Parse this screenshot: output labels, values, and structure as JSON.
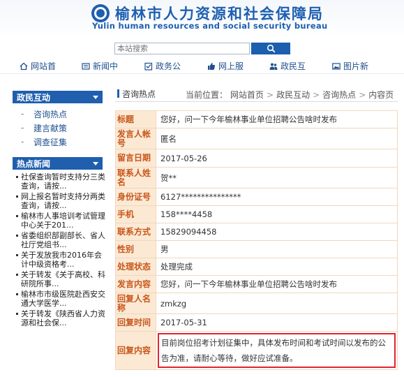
{
  "site": {
    "title": "榆林市人力资源和社会保障局",
    "subtitle": "Yulin human resources and social security bureau"
  },
  "search": {
    "placeholder": "本站搜索"
  },
  "nav": [
    {
      "label": "网站首",
      "icon": "home-icon"
    },
    {
      "label": "新闻中",
      "icon": "newspaper-icon"
    },
    {
      "label": "政务公",
      "icon": "checkbox-icon"
    },
    {
      "label": "网上服",
      "icon": "thumbs-up-icon"
    },
    {
      "label": "政民互",
      "icon": "people-icon"
    },
    {
      "label": "图片新",
      "icon": "image-icon"
    }
  ],
  "sidebar": {
    "section1_title": "政民互动",
    "section1_items": [
      "咨询热点",
      "建言献策",
      "调查征集"
    ],
    "section2_title": "热点新闻",
    "hot_news": [
      "社保查询暂时支持分三类查询，请按...",
      "网上报名暂时支持分两类查询，请按...",
      "榆林市人事培训考试管理中心关于201...",
      "省委组织部副部长、省人社厅党组书...",
      "关于发放我市2016年会计中级资格考...",
      "关于转发《关于高校、科研院所事...",
      "榆林市市级医院赴西安交通大学医学...",
      "关于转发《陕西省人力资源和社会保..."
    ]
  },
  "breadcrumb": {
    "section_title": "咨询热点",
    "location_label": "当前位置：",
    "path": [
      "网站首页",
      "政民互动",
      "咨询热点",
      "内容页"
    ]
  },
  "detail": {
    "rows": [
      {
        "label": "标题",
        "value": "您好，问一下今年榆林事业单位招聘公告啥时发布"
      },
      {
        "label": "发言人帐号",
        "value": "匿名"
      },
      {
        "label": "留言日期",
        "value": "2017-05-26"
      },
      {
        "label": "联系人姓名",
        "value": "贺**"
      },
      {
        "label": "身份证号",
        "value": "6127***************"
      },
      {
        "label": "手机",
        "value": "158****4458"
      },
      {
        "label": "联系方式",
        "value": "15829094458"
      },
      {
        "label": "性别",
        "value": "男"
      },
      {
        "label": "处理状态",
        "value": "处理完成"
      },
      {
        "label": "发言内容",
        "value": "您好，问一下今年榆林事业单位招聘公告啥时发布"
      },
      {
        "label": "回复人名称",
        "value": "zmkzg"
      },
      {
        "label": "回复时间",
        "value": "2017-05-31"
      }
    ],
    "reply_label": "回复内容",
    "reply_content": "目前岗位招考计划征集中，具体发布时间和考试时间以发布的公告为准，请耐心等待，做好应试准备。"
  },
  "colors": {
    "brand_blue": "#1f5fae",
    "label_bg": "#fbe9d4",
    "label_text": "#c8561a",
    "highlight_border": "#e0242c"
  }
}
